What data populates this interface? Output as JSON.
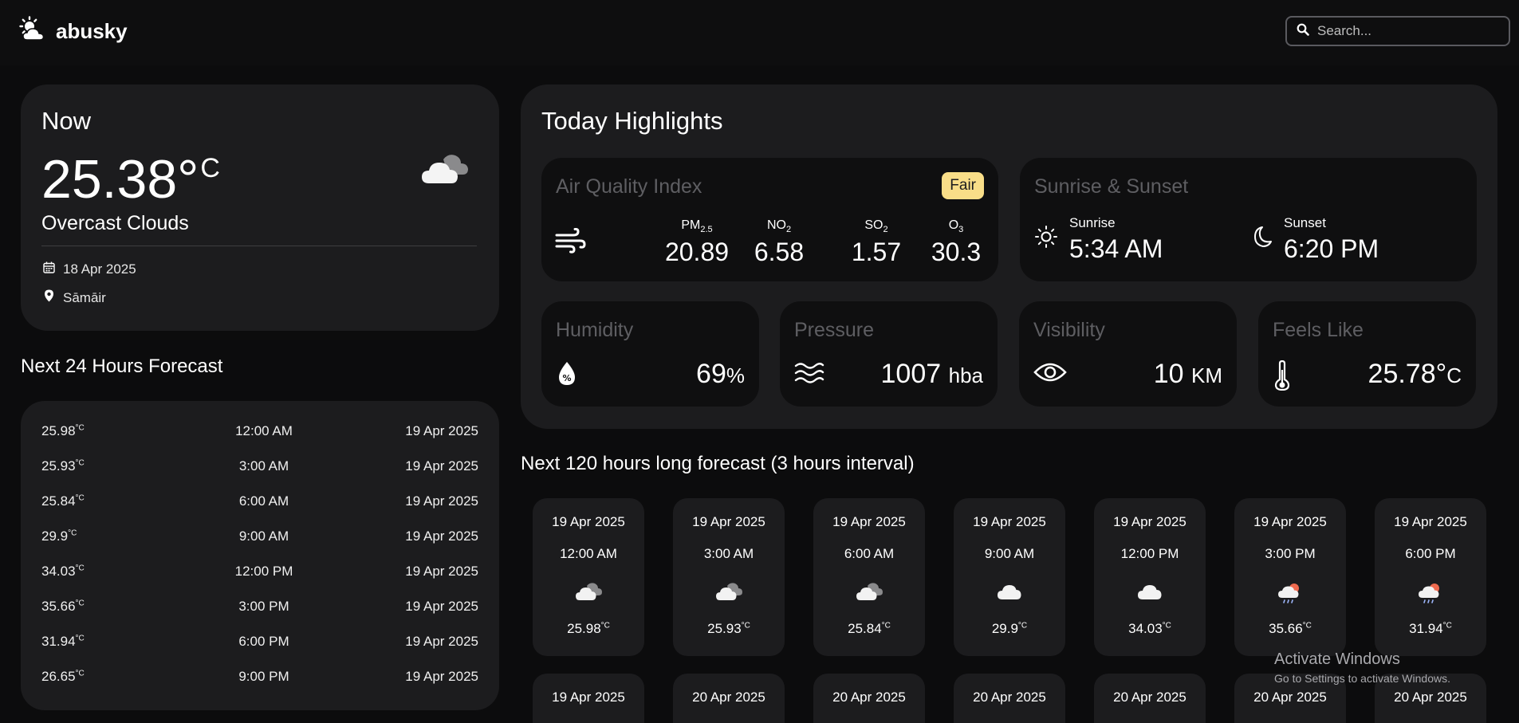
{
  "app": {
    "name": "abusky"
  },
  "search": {
    "placeholder": "Search..."
  },
  "now": {
    "title": "Now",
    "temp": "25.38°",
    "unit": "C",
    "description": "Overcast Clouds",
    "date": "18 Apr 2025",
    "location": "Sāmāir",
    "icon": "overcast-clouds-icon"
  },
  "hours24": {
    "title": "Next 24 Hours Forecast",
    "unit": "°C",
    "rows": [
      {
        "temp": "25.98",
        "time": "12:00 AM",
        "date": "19 Apr 2025"
      },
      {
        "temp": "25.93",
        "time": "3:00 AM",
        "date": "19 Apr 2025"
      },
      {
        "temp": "25.84",
        "time": "6:00 AM",
        "date": "19 Apr 2025"
      },
      {
        "temp": "29.9",
        "time": "9:00 AM",
        "date": "19 Apr 2025"
      },
      {
        "temp": "34.03",
        "time": "12:00 PM",
        "date": "19 Apr 2025"
      },
      {
        "temp": "35.66",
        "time": "3:00 PM",
        "date": "19 Apr 2025"
      },
      {
        "temp": "31.94",
        "time": "6:00 PM",
        "date": "19 Apr 2025"
      },
      {
        "temp": "26.65",
        "time": "9:00 PM",
        "date": "19 Apr 2025"
      }
    ]
  },
  "highlights": {
    "title": "Today Highlights",
    "aqi": {
      "label": "Air Quality Index",
      "badge": "Fair",
      "badge_color": "#f9de88",
      "pollutants": [
        {
          "name": "PM",
          "sub": "2.5",
          "value": "20.89"
        },
        {
          "name": "NO",
          "sub": "2",
          "value": "6.58"
        },
        {
          "name": "SO",
          "sub": "2",
          "value": "1.57"
        },
        {
          "name": "O",
          "sub": "3",
          "value": "30.3"
        }
      ]
    },
    "sun": {
      "label": "Sunrise & Sunset",
      "sunrise_label": "Sunrise",
      "sunrise": "5:34 AM",
      "sunset_label": "Sunset",
      "sunset": "6:20 PM"
    },
    "humidity": {
      "label": "Humidity",
      "value": "69",
      "unit": "%"
    },
    "pressure": {
      "label": "Pressure",
      "value": "1007",
      "unit": "hba"
    },
    "visibility": {
      "label": "Visibility",
      "value": "10",
      "unit": "KM"
    },
    "feels_like": {
      "label": "Feels Like",
      "value": "25.78°",
      "unit": "C"
    }
  },
  "long_forecast": {
    "title": "Next 120 hours long forecast (3 hours interval)",
    "unit": "°C",
    "cards": [
      {
        "date": "19 Apr 2025",
        "time": "12:00 AM",
        "temp": "25.98",
        "icon": "broken-clouds-icon"
      },
      {
        "date": "19 Apr 2025",
        "time": "3:00 AM",
        "temp": "25.93",
        "icon": "broken-clouds-icon"
      },
      {
        "date": "19 Apr 2025",
        "time": "6:00 AM",
        "temp": "25.84",
        "icon": "broken-clouds-icon"
      },
      {
        "date": "19 Apr 2025",
        "time": "9:00 AM",
        "temp": "29.9",
        "icon": "cloud-icon"
      },
      {
        "date": "19 Apr 2025",
        "time": "12:00 PM",
        "temp": "34.03",
        "icon": "cloud-icon"
      },
      {
        "date": "19 Apr 2025",
        "time": "3:00 PM",
        "temp": "35.66",
        "icon": "sun-cloud-rain-icon"
      },
      {
        "date": "19 Apr 2025",
        "time": "6:00 PM",
        "temp": "31.94",
        "icon": "sun-cloud-rain-icon"
      }
    ],
    "next_row_dates": [
      "19 Apr 2025",
      "20 Apr 2025",
      "20 Apr 2025",
      "20 Apr 2025",
      "20 Apr 2025",
      "20 Apr 2025",
      "20 Apr 2025"
    ]
  },
  "watermark": {
    "title": "Activate Windows",
    "subtitle": "Go to Settings to activate Windows."
  }
}
